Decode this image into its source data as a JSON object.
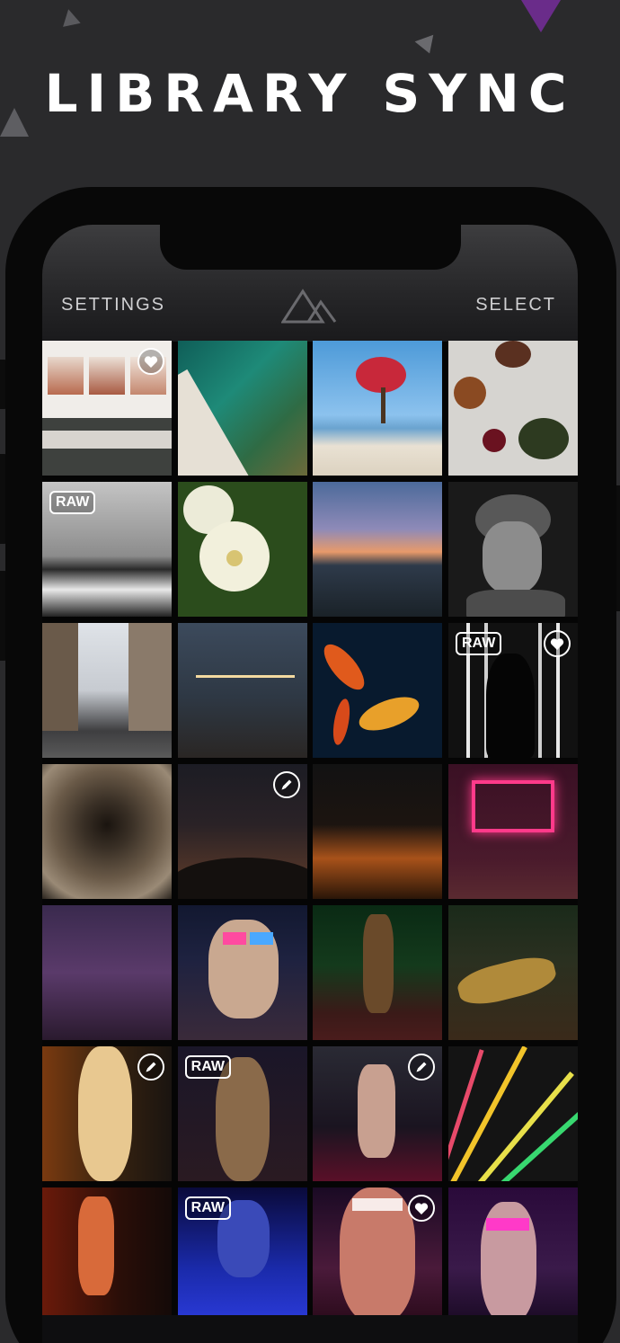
{
  "headline": "LIBRARY SYNC",
  "toolbar": {
    "settings_label": "SETTINGS",
    "select_label": "SELECT",
    "logo_icon": "mountain-logo-icon"
  },
  "badge_text": "RAW",
  "colors": {
    "background": "#2a2a2c",
    "accent_triangle": "#6a2c8a",
    "header_text": "#cfcfd1"
  },
  "photos": [
    {
      "name": "gallery-prints",
      "badge": "",
      "icon": "heart"
    },
    {
      "name": "aerial-lagoon",
      "badge": "",
      "icon": ""
    },
    {
      "name": "tree-on-beach",
      "badge": "",
      "icon": ""
    },
    {
      "name": "dinner-table",
      "badge": "",
      "icon": ""
    },
    {
      "name": "surfer-bw",
      "badge": "RAW",
      "icon": ""
    },
    {
      "name": "white-dahlias",
      "badge": "",
      "icon": ""
    },
    {
      "name": "sunset-village",
      "badge": "",
      "icon": ""
    },
    {
      "name": "portrait-glasses-bw",
      "badge": "",
      "icon": ""
    },
    {
      "name": "city-street",
      "badge": "",
      "icon": ""
    },
    {
      "name": "string-lights-dusk",
      "badge": "",
      "icon": ""
    },
    {
      "name": "koi-fish",
      "badge": "",
      "icon": ""
    },
    {
      "name": "silhouette-lights",
      "badge": "RAW",
      "icon": "heart"
    },
    {
      "name": "spiral-staircase",
      "badge": "",
      "icon": ""
    },
    {
      "name": "starry-sky",
      "badge": "",
      "icon": "edit"
    },
    {
      "name": "tree-silhouette-sunset",
      "badge": "",
      "icon": ""
    },
    {
      "name": "neon-pink-room",
      "badge": "",
      "icon": ""
    },
    {
      "name": "purple-haze-figure",
      "badge": "",
      "icon": ""
    },
    {
      "name": "neon-sunglasses",
      "badge": "",
      "icon": ""
    },
    {
      "name": "bar-green-lights",
      "badge": "",
      "icon": ""
    },
    {
      "name": "roller-skates",
      "badge": "",
      "icon": ""
    },
    {
      "name": "blonde-portrait",
      "badge": "",
      "icon": "edit"
    },
    {
      "name": "neon-portrait-red",
      "badge": "RAW",
      "icon": ""
    },
    {
      "name": "dance-floor",
      "badge": "",
      "icon": "edit"
    },
    {
      "name": "neon-streaks",
      "badge": "",
      "icon": ""
    },
    {
      "name": "orange-lockers",
      "badge": "",
      "icon": ""
    },
    {
      "name": "blue-glasses-portrait",
      "badge": "RAW",
      "icon": ""
    },
    {
      "name": "violet-portrait",
      "badge": "",
      "icon": "heart"
    },
    {
      "name": "pink-glasses-portrait",
      "badge": "",
      "icon": ""
    }
  ]
}
